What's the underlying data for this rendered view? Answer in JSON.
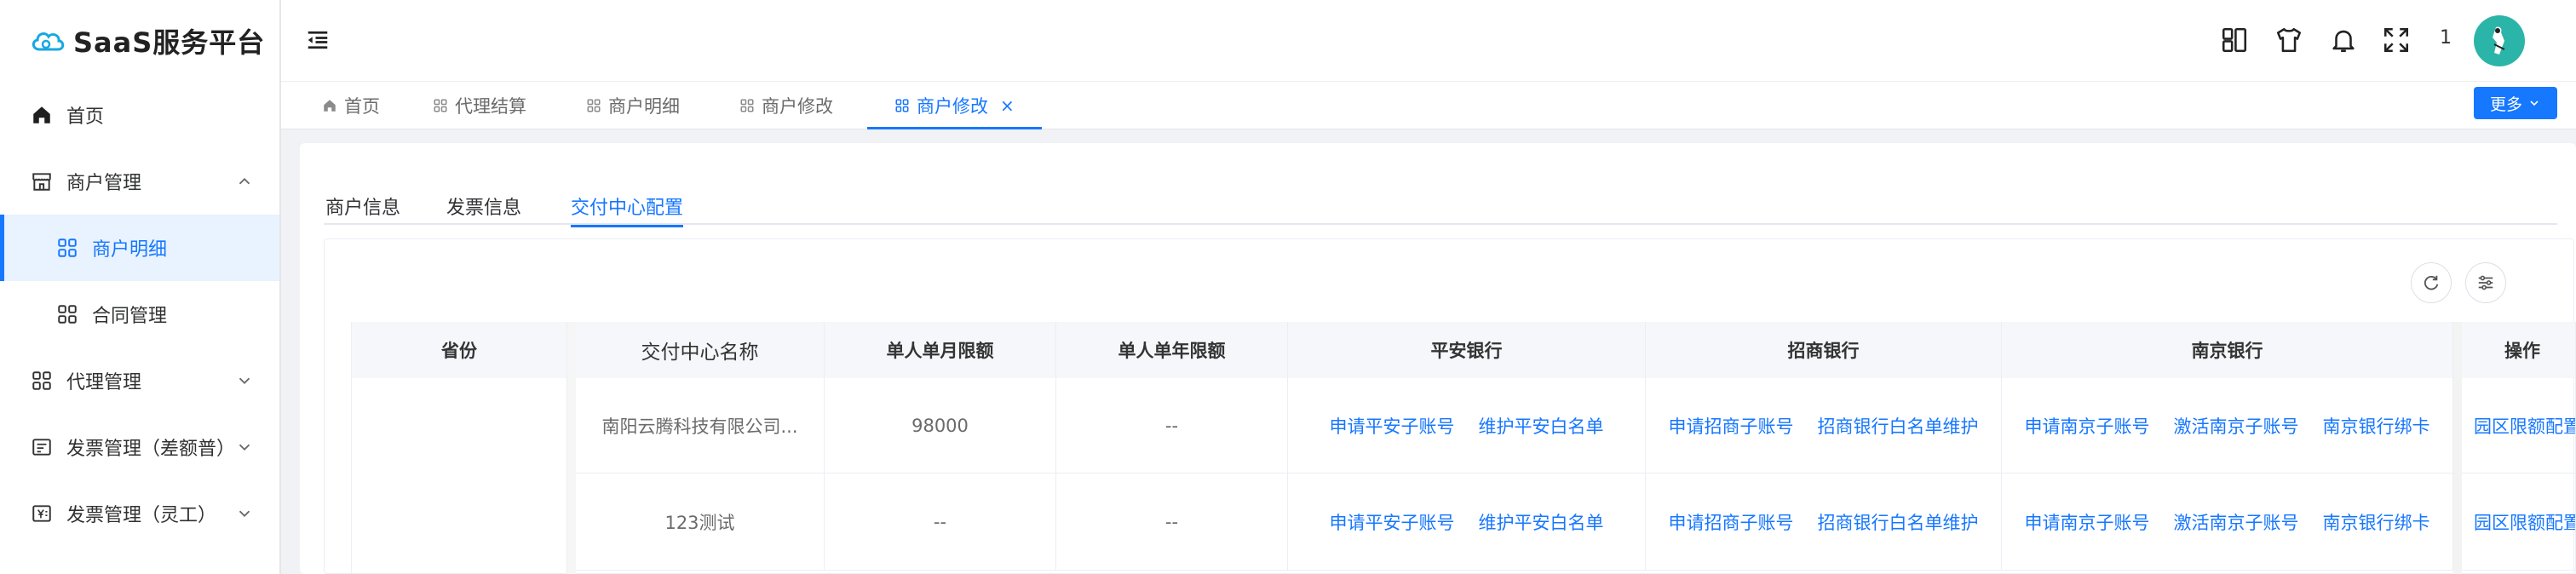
{
  "app": {
    "title": "SaaS服务平台"
  },
  "sidebar": {
    "items": [
      {
        "label": "首页"
      },
      {
        "label": "商户管理"
      },
      {
        "label": "商户明细"
      },
      {
        "label": "合同管理"
      },
      {
        "label": "代理管理"
      },
      {
        "label": "发票管理（差额普）"
      },
      {
        "label": "发票管理（灵工）"
      }
    ]
  },
  "header": {
    "notification_count": "1"
  },
  "tags": [
    {
      "label": "首页"
    },
    {
      "label": "代理结算"
    },
    {
      "label": "商户明细"
    },
    {
      "label": "商户修改"
    },
    {
      "label": "商户修改"
    }
  ],
  "more_label": "更多",
  "inner_tabs": [
    {
      "label": "商户信息"
    },
    {
      "label": "发票信息"
    },
    {
      "label": "交付中心配置"
    }
  ],
  "table": {
    "headers": [
      "省份",
      "交付中心名称",
      "单人单月限额",
      "单人单年限额",
      "平安银行",
      "招商银行",
      "南京银行",
      "操作"
    ],
    "rows": [
      {
        "name": "南阳云腾科技有限公司...",
        "monthly": "98000",
        "yearly": "--",
        "pingan": [
          "申请平安子账号",
          "维护平安白名单"
        ],
        "cmb": [
          "申请招商子账号",
          "招商银行白名单维护"
        ],
        "nanjing": [
          "申请南京子账号",
          "激活南京子账号",
          "南京银行绑卡"
        ],
        "op": "园区限额配置"
      },
      {
        "name": "123测试",
        "monthly": "--",
        "yearly": "--",
        "pingan": [
          "申请平安子账号",
          "维护平安白名单"
        ],
        "cmb": [
          "申请招商子账号",
          "招商银行白名单维护"
        ],
        "nanjing": [
          "申请南京子账号",
          "激活南京子账号",
          "南京银行绑卡"
        ],
        "op": "园区限额配置"
      }
    ]
  },
  "colors": {
    "accent": "#1677ff",
    "logo": "#18a8e0",
    "avatar": "#2bb5a8"
  }
}
